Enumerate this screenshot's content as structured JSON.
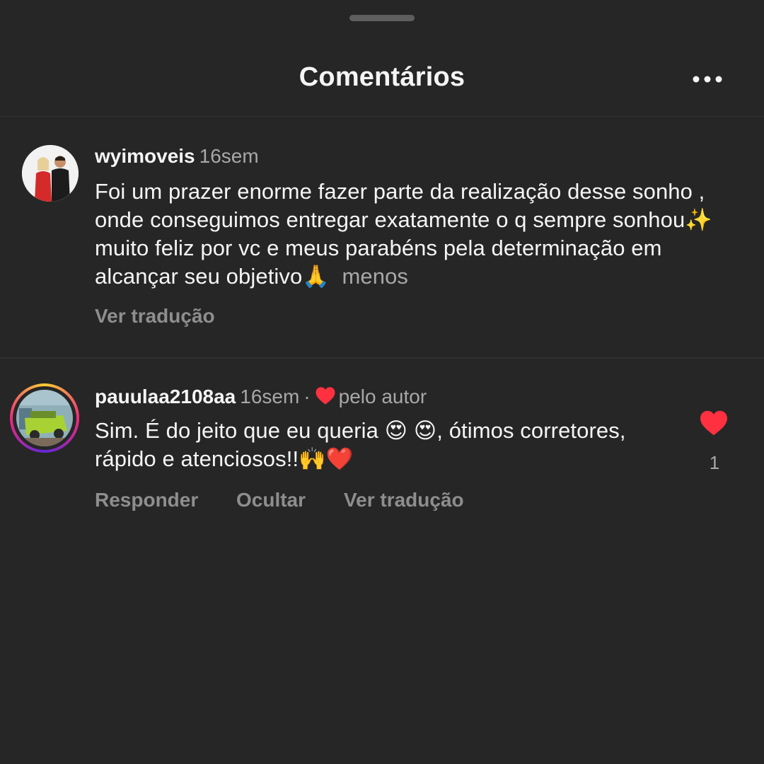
{
  "sheet": {
    "title": "Comentários",
    "more_icon": "more-horizontal-icon"
  },
  "comments": [
    {
      "username": "wyimoveis",
      "time": "16sem",
      "text_main": "Foi um prazer enorme fazer parte da realização desse sonho , onde conseguimos entregar exatamente o q sempre sonhou",
      "emoji_sparkles": "✨",
      "text_mid": " muito feliz por vc e meus parabéns pela determinação em alcançar  seu objetivo",
      "emoji_pray": "🙏",
      "more_label": "menos",
      "translate_label": "Ver tradução"
    },
    {
      "username": "pauulaa2108aa",
      "time": "16sem",
      "separator": "·",
      "liked_by_label": "pelo autor",
      "text_start": "Sim. É do jeito que eu queria ",
      "emoji_hearteyes_1": "😍",
      "emoji_hearteyes_2": "😍",
      "text_mid": ", ótimos corretores, rápido e atenciosos!!",
      "emoji_raised_hands": "🙌",
      "emoji_red_heart": "❤️",
      "reply_label": "Responder",
      "hide_label": "Ocultar",
      "translate_label": "Ver tradução",
      "like_count": "1",
      "like_color": "#ff3040"
    }
  ],
  "colors": {
    "background": "#262626",
    "text_primary": "#f5f5f5",
    "text_secondary": "#a8a8a8",
    "like_red": "#ff3040"
  }
}
